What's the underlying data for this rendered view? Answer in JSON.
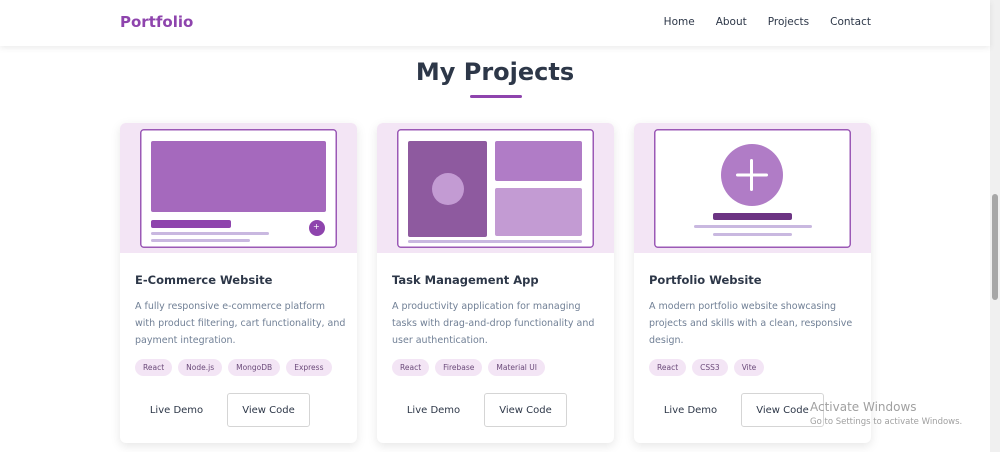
{
  "nav": {
    "logo": "Portfolio",
    "links": [
      "Home",
      "About",
      "Projects",
      "Contact"
    ]
  },
  "section": {
    "title": "My Projects"
  },
  "colors": {
    "accent": "#8e44ad",
    "tag_bg": "#f3e5f5",
    "image_bg": "#f3e5f5"
  },
  "projects": [
    {
      "title": "E-Commerce Website",
      "description": "A fully responsive e-commerce platform with product filtering, cart functionality, and payment integration.",
      "tags": [
        "React",
        "Node.js",
        "MongoDB",
        "Express"
      ],
      "demo_label": "Live Demo",
      "code_label": "View Code",
      "cart_symbol": "+"
    },
    {
      "title": "Task Management App",
      "description": "A productivity application for managing tasks with drag-and-drop functionality and user authentication.",
      "tags": [
        "React",
        "Firebase",
        "Material UI"
      ],
      "demo_label": "Live Demo",
      "code_label": "View Code"
    },
    {
      "title": "Portfolio Website",
      "description": "A modern portfolio website showcasing projects and skills with a clean, responsive design.",
      "tags": [
        "React",
        "CSS3",
        "Vite"
      ],
      "demo_label": "Live Demo",
      "code_label": "View Code"
    }
  ],
  "watermark": {
    "title": "Activate Windows",
    "subtitle": "Go to Settings to activate Windows."
  }
}
